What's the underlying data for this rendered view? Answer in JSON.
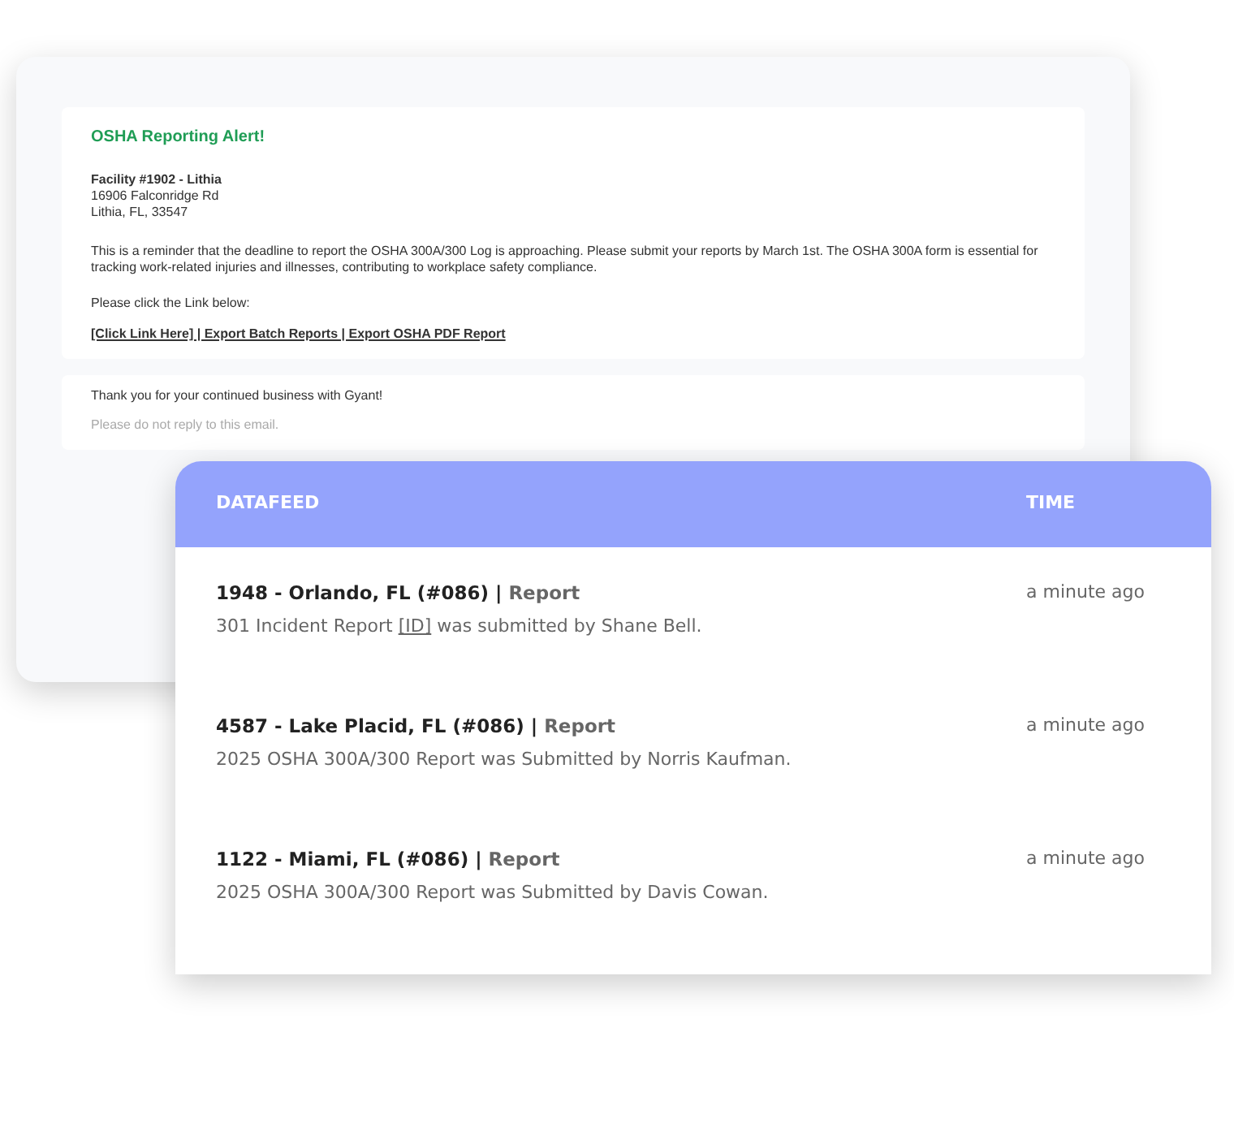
{
  "email": {
    "title": "OSHA Reporting Alert!",
    "facility": {
      "name": "Facility #1902 - Lithia",
      "address": [
        "16906 Falconridge Rd",
        "Lithia, FL, 33547"
      ]
    },
    "message": "This is a reminder that the deadline to report the OSHA 300A/300 Log is approaching. Please submit your reports by March 1st. The OSHA 300A form is essential for tracking work-related injuries and illnesses, contributing to workplace safety compliance.",
    "prompt": "Please click the Link below:",
    "links": "[Click Link Here] | Export Batch Reports | Export OSHA PDF Report",
    "thanks": "Thank you for your continued business with Gyant!",
    "footer": "Please do not reply to this email."
  },
  "feed": {
    "columns": [
      "DATAFEED",
      "TIME"
    ],
    "rows": [
      {
        "title": "1948 - Orlando, FL (#086) |",
        "link": "Report",
        "description": [
          {
            "kind": "text",
            "text": "301 Incident Report "
          },
          {
            "kind": "link",
            "text": "[ID]"
          },
          {
            "kind": "text",
            "text": " was submitted by Shane Bell."
          }
        ],
        "time": "a minute ago"
      },
      {
        "title": "4587 - Lake Placid, FL (#086) |",
        "link": "Report",
        "description": [
          {
            "kind": "text",
            "text": "2025 OSHA 300A/300 Report was Submitted by Norris Kaufman."
          }
        ],
        "time": "a minute ago"
      },
      {
        "title": "1122 - Miami, FL (#086) |",
        "link": "Report",
        "description": [
          {
            "kind": "text",
            "text": "2025 OSHA 300A/300 Report was Submitted by Davis Cowan."
          }
        ],
        "time": "a minute ago"
      }
    ]
  }
}
